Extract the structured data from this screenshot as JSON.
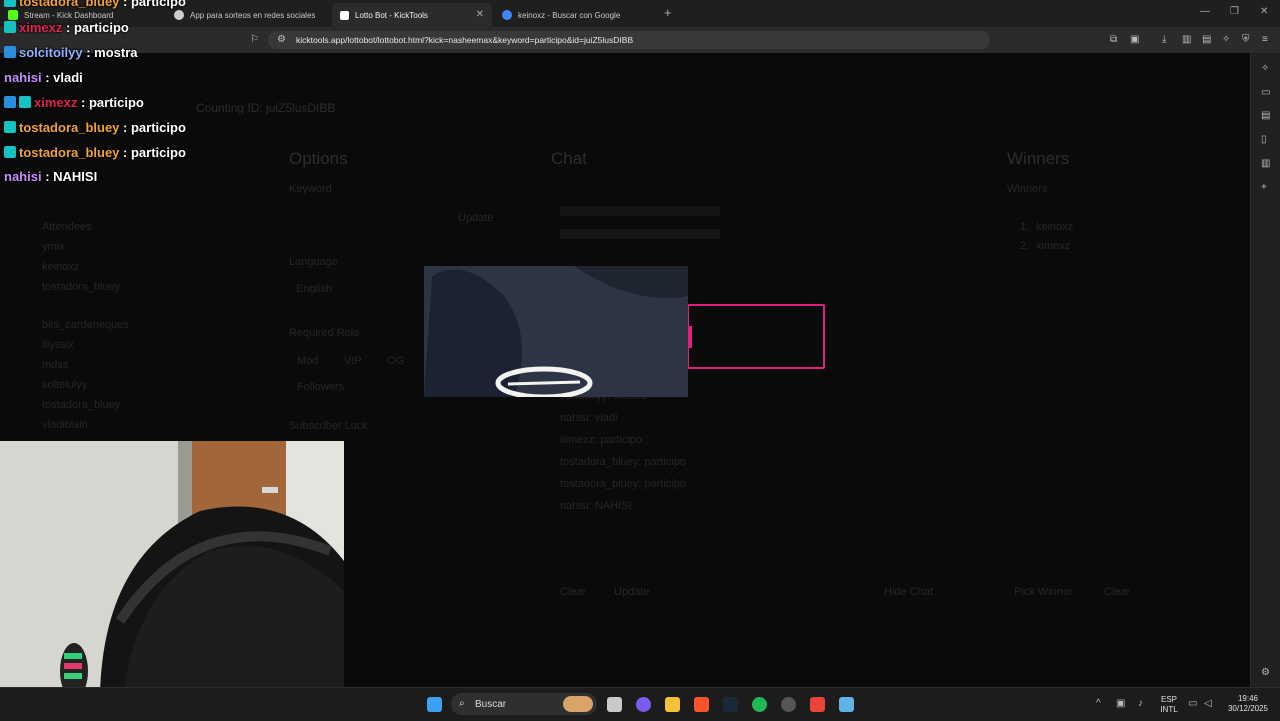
{
  "browser": {
    "tabs": [
      {
        "label": "Stream - Kick Dashboard",
        "favicon_color": "#53fc18",
        "active": false
      },
      {
        "label": "App para sorteos en redes sociales",
        "favicon_color": "#cfcfcf",
        "active": false
      },
      {
        "label": "Lotto Bot - KickTools",
        "favicon_color": "#ffffff",
        "active": true
      },
      {
        "label": "keinoxz - Buscar con Google",
        "favicon_color": "#4285f4",
        "active": false
      }
    ],
    "url": "kicktools.app/lottobot/lottobot.html?kick=nasheemax&keyword=participo&id=juiZ5lusDIBB"
  },
  "page": {
    "brand_title": "KickTools",
    "counting_label": "Counting ID: juiZ5lusDIBB",
    "panels": {
      "options_title": "Options",
      "chat_title": "Chat",
      "winners_title": "Winners"
    },
    "options": {
      "keyword_label": "Keyword",
      "update_button": "Update",
      "language_label": "Language",
      "language_value": "English",
      "required_role_label": "Required Role",
      "roles": [
        "Mod",
        "VIP",
        "OG"
      ],
      "followers_label": "Followers",
      "subscriber_label": "Subscriber Luck"
    },
    "attendees": [
      "Attendees",
      "ymix",
      "keinoxz",
      "tostadora_bluey",
      "",
      "bits_cardeneques",
      "lilyssix",
      "mdss",
      "soltelulyy",
      "tostadora_bluey",
      "vladiblain"
    ],
    "chat_lines": [
      "solcitoilyy: mostra",
      "nahisi: vladi",
      "ximexz: participo",
      "tostadora_bluey: participo",
      "tostadora_bluey: participo",
      "nahisi: NAHISI"
    ],
    "chat_buttons": {
      "clear": "Clear",
      "update": "Update",
      "hide": "Hide Chat"
    },
    "winners": {
      "header": "Winners",
      "rows": [
        {
          "rank": "1.",
          "name": "keinoxz"
        },
        {
          "rank": "2.",
          "name": "ximexz"
        }
      ],
      "pick_button": "Pick Winner",
      "clear_button": "Clear"
    }
  },
  "stream_chat": [
    {
      "user": "tostadora_bluey",
      "message": "participo",
      "color": "#f0a33a",
      "badge": "#16c2c2"
    },
    {
      "user": "ximexz",
      "message": "participo",
      "color": "#e0244f",
      "badge": "#16c2c2"
    },
    {
      "user": "solcitoilyy",
      "message": "mostra",
      "color": "#8fb1ff",
      "badge": "#2b8fe0"
    },
    {
      "user": "nahisi",
      "message": "vladi",
      "color": "#c58dff",
      "badge": ""
    },
    {
      "user": "ximexz",
      "message": "participo",
      "color": "#e0244f",
      "badge": "#2b8fe0"
    },
    {
      "user": "tostadora_bluey",
      "message": "participo",
      "color": "#f0a33a",
      "badge": "#16c2c2"
    },
    {
      "user": "tostadora_bluey",
      "message": "participo",
      "color": "#f0a33a",
      "badge": "#16c2c2"
    },
    {
      "user": "nahisi",
      "message": "NAHISI",
      "color": "#c58dff",
      "badge": ""
    }
  ],
  "taskbar": {
    "search_label": "Buscar",
    "lang_top": "ESP",
    "lang_bottom": "INTL",
    "time": "19:46",
    "date": "30/12/2025"
  },
  "colors": {
    "accent_pink": "#e0207d",
    "kick_green": "#53fc18"
  }
}
